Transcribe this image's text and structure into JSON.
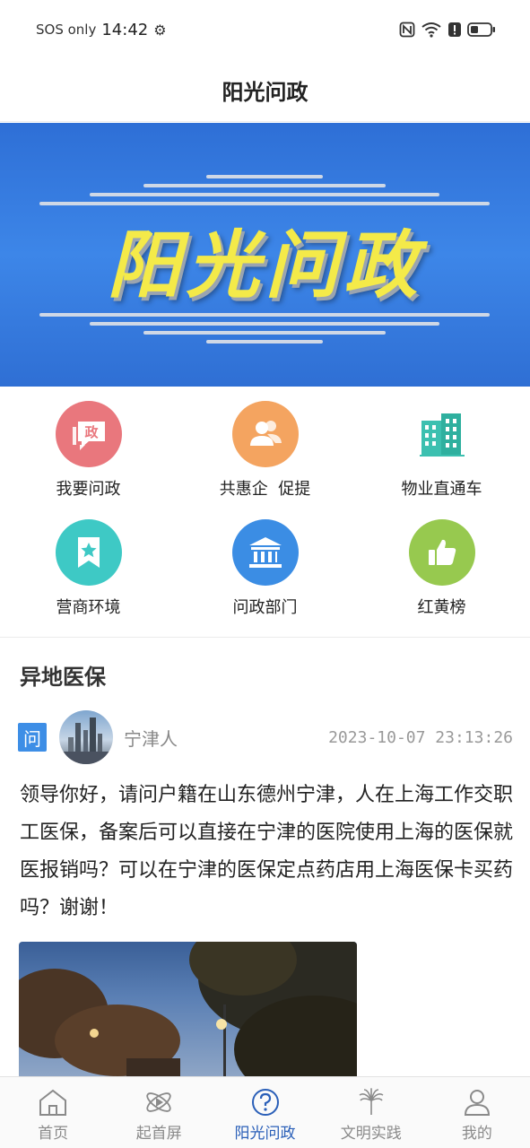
{
  "status_bar": {
    "carrier": "SOS only",
    "time": "14:42",
    "icons": [
      "settings-icon",
      "nfc-icon",
      "wifi-icon",
      "alert-icon",
      "battery-icon"
    ]
  },
  "header": {
    "title": "阳光问政"
  },
  "banner": {
    "title": "阳光问政"
  },
  "quick_menu": [
    {
      "label": "我要问政",
      "icon": "zheng-chat-icon",
      "color": "#e9777d"
    },
    {
      "label": "共惠企  促提",
      "icon": "users-icon",
      "color": "#f4a460"
    },
    {
      "label": "物业直通车",
      "icon": "building-icon",
      "color": "#3cc0b0"
    },
    {
      "label": "营商环境",
      "icon": "bookmark-star-icon",
      "color": "#3ec9c5"
    },
    {
      "label": "问政部门",
      "icon": "institution-icon",
      "color": "#3b8de4"
    },
    {
      "label": "红黄榜",
      "icon": "thumbs-up-icon",
      "color": "#97c94f"
    }
  ],
  "post": {
    "section_title": "异地医保",
    "badge": "问",
    "author": "宁津人",
    "timestamp": "2023-10-07  23:13:26",
    "body": "领导你好，请问户籍在山东德州宁津，人在上海工作交职工医保，备案后可以直接在宁津的医院使用上海的医保就医报销吗？可以在宁津的医保定点药店用上海医保卡买药吗？谢谢！"
  },
  "tab_bar": {
    "active": "阳光问政",
    "tabs": [
      {
        "label": "首页",
        "icon": "home-icon"
      },
      {
        "label": "起首屏",
        "icon": "atom-play-icon"
      },
      {
        "label": "阳光问政",
        "icon": "question-circle-icon"
      },
      {
        "label": "文明实践",
        "icon": "flame-emblem-icon"
      },
      {
        "label": "我的",
        "icon": "user-icon"
      }
    ]
  }
}
